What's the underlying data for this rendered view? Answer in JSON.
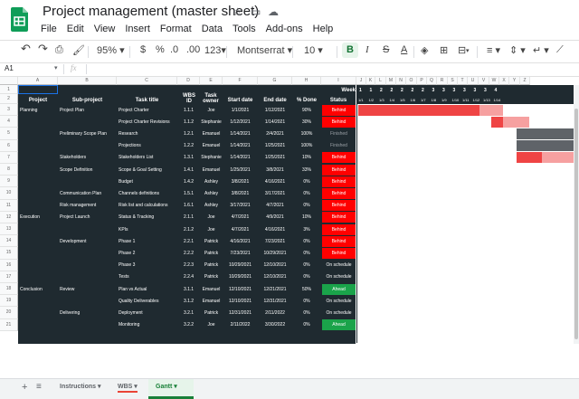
{
  "app": {
    "title": "Project management (master sheet)",
    "menus": [
      "File",
      "Edit",
      "View",
      "Insert",
      "Format",
      "Data",
      "Tools",
      "Add-ons",
      "Help"
    ]
  },
  "toolbar": {
    "zoom": "95%",
    "currency": "$",
    "percent": "%",
    "dec_less": ".0",
    ".00": ".00",
    "more_formats": "123",
    "font": "Montserrat",
    "font_size": "10",
    "bold": "B",
    "italic": "I",
    "strike": "S",
    "text_color": "A"
  },
  "formula_bar": {
    "cell_ref": "A1",
    "fx": "fx",
    "value": ""
  },
  "columns": [
    "A",
    "B",
    "C",
    "D",
    "E",
    "F",
    "G",
    "H",
    "I",
    "J",
    "K",
    "L",
    "M",
    "N",
    "O",
    "P",
    "Q",
    "R",
    "S",
    "T",
    "U",
    "V",
    "W",
    "X",
    "Y",
    "Z"
  ],
  "rows": [
    "1",
    "2",
    "3",
    "4",
    "5",
    "6",
    "7",
    "8",
    "9",
    "10",
    "11",
    "12",
    "13",
    "14",
    "15",
    "16",
    "17",
    "18",
    "19",
    "20",
    "21"
  ],
  "headers": {
    "project": "Project",
    "subproject": "Sub-project",
    "task": "Task title",
    "wbs": "WBS ID",
    "owner": "Task owner",
    "start": "Start date",
    "end": "End date",
    "done": "% Done",
    "status": "Status",
    "week": "Week"
  },
  "week_numbers": [
    "1",
    "1",
    "2",
    "2",
    "2",
    "2",
    "2",
    "3",
    "3",
    "3",
    "3",
    "3",
    "3",
    "4"
  ],
  "week_days": [
    "1/1",
    "1/2",
    "1/3",
    "1/4",
    "1/5",
    "1/6",
    "1/7",
    "1/8",
    "1/9",
    "1/10",
    "1/11",
    "1/12",
    "1/13",
    "1/14"
  ],
  "tasks": [
    {
      "project": "Planning",
      "sub": "Project Plan",
      "task": "Project Charter",
      "wbs": "1.1.1",
      "owner": "Joe",
      "start": "1/1/2021",
      "end": "1/12/2021",
      "done": "90%",
      "status": "Behind",
      "status_color": "#ff0000"
    },
    {
      "project": "",
      "sub": "",
      "task": "Project Charter Revisions",
      "wbs": "1.1.2",
      "owner": "Stephanie",
      "start": "1/12/2021",
      "end": "1/14/2021",
      "done": "30%",
      "status": "Behind",
      "status_color": "#ff0000"
    },
    {
      "project": "",
      "sub": "Preliminary Scope Plan",
      "task": "Research",
      "wbs": "1.2.1",
      "owner": "Emanuel",
      "start": "1/14/2021",
      "end": "2/4/2021",
      "done": "100%",
      "status": "Finished",
      "status_color": "#1f2a30"
    },
    {
      "project": "",
      "sub": "",
      "task": "Projections",
      "wbs": "1.2.2",
      "owner": "Emanuel",
      "start": "1/14/2021",
      "end": "1/25/2021",
      "done": "100%",
      "status": "Finished",
      "status_color": "#1f2a30"
    },
    {
      "project": "",
      "sub": "Stakeholders",
      "task": "Stakeholders List",
      "wbs": "1.3.1",
      "owner": "Stephanie",
      "start": "1/14/2021",
      "end": "1/25/2021",
      "done": "10%",
      "status": "Behind",
      "status_color": "#ff0000"
    },
    {
      "project": "",
      "sub": "Scope Definition",
      "task": "Scope & Goal Setting",
      "wbs": "1.4.1",
      "owner": "Emanuel",
      "start": "1/25/2021",
      "end": "3/8/2021",
      "done": "33%",
      "status": "Behind",
      "status_color": "#ff0000"
    },
    {
      "project": "",
      "sub": "",
      "task": "Budget",
      "wbs": "1.4.2",
      "owner": "Ashley",
      "start": "3/8/2021",
      "end": "4/16/2021",
      "done": "0%",
      "status": "Behind",
      "status_color": "#ff0000"
    },
    {
      "project": "",
      "sub": "Communication Plan",
      "task": "Channels definitions",
      "wbs": "1.5.1",
      "owner": "Ashley",
      "start": "3/8/2021",
      "end": "3/17/2021",
      "done": "0%",
      "status": "Behind",
      "status_color": "#ff0000"
    },
    {
      "project": "",
      "sub": "Risk management",
      "task": "Risk list and calculations",
      "wbs": "1.6.1",
      "owner": "Ashley",
      "start": "3/17/2021",
      "end": "4/7/2021",
      "done": "0%",
      "status": "Behind",
      "status_color": "#ff0000"
    },
    {
      "project": "Execution",
      "sub": "Project Launch",
      "task": "Status & Tracking",
      "wbs": "2.1.1",
      "owner": "Joe",
      "start": "4/7/2021",
      "end": "4/9/2021",
      "done": "10%",
      "status": "Behind",
      "status_color": "#ff0000"
    },
    {
      "project": "",
      "sub": "",
      "task": "KPIs",
      "wbs": "2.1.2",
      "owner": "Joe",
      "start": "4/7/2021",
      "end": "4/16/2021",
      "done": "3%",
      "status": "Behind",
      "status_color": "#ff0000"
    },
    {
      "project": "",
      "sub": "Development",
      "task": "Phase 1",
      "wbs": "2.2.1",
      "owner": "Patrick",
      "start": "4/16/2021",
      "end": "7/23/2021",
      "done": "0%",
      "status": "Behind",
      "status_color": "#ff0000"
    },
    {
      "project": "",
      "sub": "",
      "task": "Phase 2",
      "wbs": "2.2.2",
      "owner": "Patrick",
      "start": "7/23/2021",
      "end": "10/29/2021",
      "done": "0%",
      "status": "Behind",
      "status_color": "#ff0000"
    },
    {
      "project": "",
      "sub": "",
      "task": "Phase 3",
      "wbs": "2.2.3",
      "owner": "Patrick",
      "start": "10/29/2021",
      "end": "12/10/2021",
      "done": "0%",
      "status": "On schedule",
      "status_color": "#1f2a30"
    },
    {
      "project": "",
      "sub": "",
      "task": "Tests",
      "wbs": "2.2.4",
      "owner": "Patrick",
      "start": "10/29/2021",
      "end": "12/10/2021",
      "done": "0%",
      "status": "On schedule",
      "status_color": "#1f2a30"
    },
    {
      "project": "Conclusion",
      "sub": "Review",
      "task": "Plan vs Actual",
      "wbs": "3.1.1",
      "owner": "Emanuel",
      "start": "12/10/2021",
      "end": "12/21/2021",
      "done": "50%",
      "status": "Ahead",
      "status_color": "#1aa34a"
    },
    {
      "project": "",
      "sub": "",
      "task": "Quality Deliverables",
      "wbs": "3.1.2",
      "owner": "Emanuel",
      "start": "12/10/2021",
      "end": "12/31/2021",
      "done": "0%",
      "status": "On schedule",
      "status_color": "#1f2a30"
    },
    {
      "project": "",
      "sub": "Delivering",
      "task": "Deployment",
      "wbs": "3.2.1",
      "owner": "Patrick",
      "start": "12/31/2021",
      "end": "2/11/2022",
      "done": "0%",
      "status": "On schedule",
      "status_color": "#1f2a30"
    },
    {
      "project": "",
      "sub": "",
      "task": "Monitoring",
      "wbs": "3.2.2",
      "owner": "Joe",
      "start": "2/11/2022",
      "end": "3/30/2022",
      "done": "0%",
      "status": "Ahead",
      "status_color": "#1aa34a"
    }
  ],
  "sheets": [
    "Instructions",
    "WBS",
    "Gantt"
  ],
  "active_sheet": "Gantt"
}
